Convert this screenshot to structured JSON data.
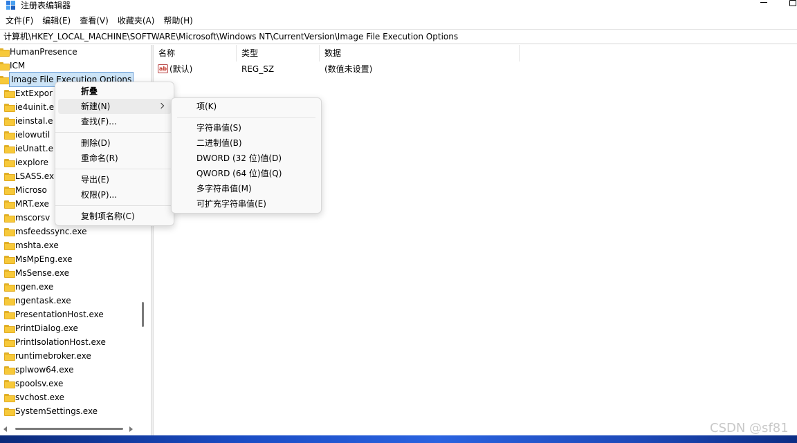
{
  "window": {
    "title": "注册表编辑器",
    "icon": "registry-editor-icon"
  },
  "menubar": {
    "items": [
      "文件(F)",
      "编辑(E)",
      "查看(V)",
      "收藏夹(A)",
      "帮助(H)"
    ]
  },
  "address": {
    "path": "计算机\\HKEY_LOCAL_MACHINE\\SOFTWARE\\Microsoft\\Windows NT\\CurrentVersion\\Image File Execution Options"
  },
  "tree": {
    "items": [
      {
        "label": "HumanPresence",
        "level": 0
      },
      {
        "label": "ICM",
        "level": 0
      },
      {
        "label": "Image File Execution Options",
        "level": 0,
        "selected": true
      },
      {
        "label": "ExtExpor",
        "level": 1
      },
      {
        "label": "ie4uinit.e",
        "level": 1
      },
      {
        "label": "ieinstal.e",
        "level": 1
      },
      {
        "label": "ielowutil",
        "level": 1
      },
      {
        "label": "ieUnatt.e",
        "level": 1
      },
      {
        "label": "iexplore",
        "level": 1
      },
      {
        "label": "LSASS.ex",
        "level": 1
      },
      {
        "label": "Microso",
        "level": 1
      },
      {
        "label": "MRT.exe",
        "level": 1
      },
      {
        "label": "mscorsv",
        "level": 1
      },
      {
        "label": "msfeedssync.exe",
        "level": 1
      },
      {
        "label": "mshta.exe",
        "level": 1
      },
      {
        "label": "MsMpEng.exe",
        "level": 1
      },
      {
        "label": "MsSense.exe",
        "level": 1
      },
      {
        "label": "ngen.exe",
        "level": 1
      },
      {
        "label": "ngentask.exe",
        "level": 1
      },
      {
        "label": "PresentationHost.exe",
        "level": 1
      },
      {
        "label": "PrintDialog.exe",
        "level": 1
      },
      {
        "label": "PrintIsolationHost.exe",
        "level": 1
      },
      {
        "label": "runtimebroker.exe",
        "level": 1
      },
      {
        "label": "splwow64.exe",
        "level": 1
      },
      {
        "label": "spoolsv.exe",
        "level": 1
      },
      {
        "label": "svchost.exe",
        "level": 1
      },
      {
        "label": "SystemSettings.exe",
        "level": 1
      }
    ]
  },
  "list": {
    "columns": [
      "名称",
      "类型",
      "数据"
    ],
    "rows": [
      {
        "name": "(默认)",
        "type": "REG_SZ",
        "data": "(数值未设置)",
        "icon": "ab-string-icon"
      }
    ]
  },
  "context_menu": {
    "items": [
      "折叠",
      "新建(N)",
      "查找(F)...",
      "删除(D)",
      "重命名(R)",
      "导出(E)",
      "权限(P)...",
      "复制项名称(C)"
    ]
  },
  "submenu": {
    "items": [
      "项(K)",
      "字符串值(S)",
      "二进制值(B)",
      "DWORD (32 位)值(D)",
      "QWORD (64 位)值(Q)",
      "多字符串值(M)",
      "可扩充字符串值(E)"
    ]
  },
  "watermark": "CSDN @sf81"
}
